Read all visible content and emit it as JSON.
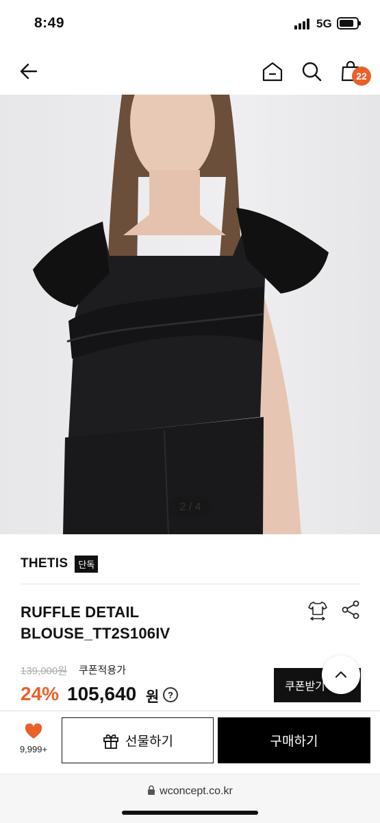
{
  "status_bar": {
    "time": "8:49",
    "network": "5G"
  },
  "nav": {
    "cart_count": "22",
    "back_icon": "arrow-left-icon",
    "home_icon": "home-icon",
    "search_icon": "search-icon",
    "cart_icon": "shopping-bag-icon"
  },
  "gallery": {
    "page_indicator": "2 / 4"
  },
  "product": {
    "brand": "THETIS",
    "exclusive_badge": "단독",
    "title_line1": "RUFFLE DETAIL",
    "title_line2": "BLOUSE_TT2S106IV",
    "original_price": "139,000원",
    "coupon_note": "쿠폰적용가",
    "discount": "24%",
    "sale_price": "105,640",
    "currency": "원",
    "help_symbol": "?",
    "coupon_button": "쿠폰받기"
  },
  "bottom": {
    "like_count": "9,999+",
    "gift_button": "선물하기",
    "buy_button": "구매하기"
  },
  "browser": {
    "url": "wconcept.co.kr"
  },
  "colors": {
    "accent": "#e9612a",
    "dark": "#111111"
  }
}
